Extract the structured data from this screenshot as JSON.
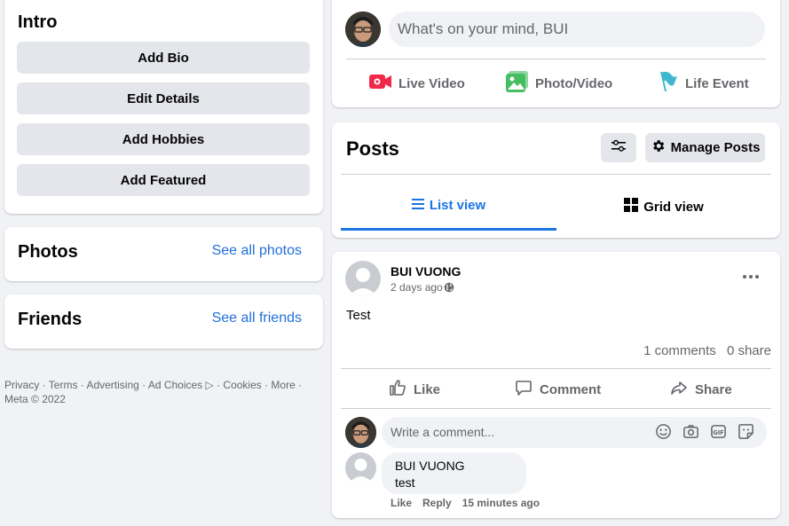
{
  "colors": {
    "accent": "#1b74e4",
    "link": "#216fdb",
    "live_red": "#f02849",
    "photo_green": "#45bd62",
    "event_teal": "#3db8d0"
  },
  "intro": {
    "title": "Intro",
    "buttons": [
      "Add Bio",
      "Edit Details",
      "Add Hobbies",
      "Add Featured"
    ]
  },
  "photos": {
    "title": "Photos",
    "link": "See all photos"
  },
  "friends": {
    "title": "Friends",
    "link": "See all friends"
  },
  "footer": {
    "text": "Privacy · Terms · Advertising · Ad Choices ▷ · Cookies · More · Meta © 2022"
  },
  "composer": {
    "placeholder": "What's on your mind, BUI",
    "actions": {
      "live": "Live Video",
      "photo": "Photo/Video",
      "event": "Life Event"
    }
  },
  "posts_header": {
    "title": "Posts",
    "manage": "Manage Posts",
    "list_view": "List view",
    "grid_view": "Grid view"
  },
  "post": {
    "author": "BUI VUONG",
    "time": "2 days ago",
    "privacy_icon": "globe-icon",
    "text": "Test",
    "comments_count": "1 comments",
    "shares_count": "0 share",
    "like": "Like",
    "comment": "Comment",
    "share": "Share",
    "comment_placeholder": "Write a comment...",
    "reply": {
      "author": "BUI VUONG",
      "text": "test",
      "like": "Like",
      "reply": "Reply",
      "time": "15 minutes ago"
    }
  }
}
